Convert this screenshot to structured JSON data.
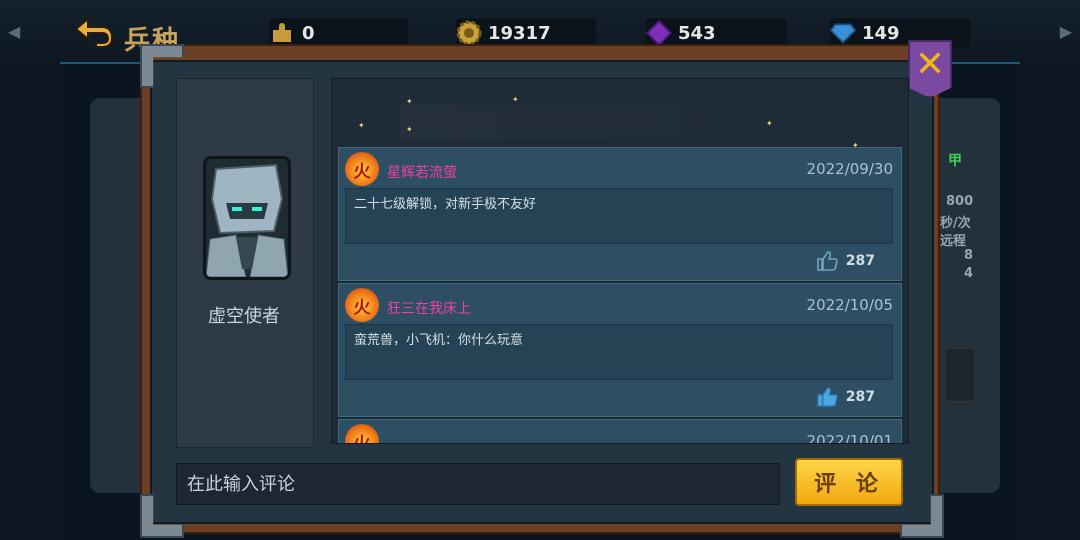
{
  "header": {
    "title": "兵种",
    "resources": [
      {
        "icon": "puzzle-icon",
        "value": "0"
      },
      {
        "icon": "gear-coin-icon",
        "value": "19317"
      },
      {
        "icon": "purple-crystal-icon",
        "value": "543"
      },
      {
        "icon": "blue-diamond-icon",
        "value": "149"
      }
    ]
  },
  "background": {
    "right_values": [
      "800",
      "秒/次",
      "远程",
      "8",
      "4"
    ],
    "right_green": "甲"
  },
  "modal": {
    "unit_name": "虚空使者",
    "comments": [
      {
        "user": "星辉若流萤",
        "date": "2022/09/30",
        "text": "二十七级解锁，对新手极不友好",
        "likes": "287",
        "liked": false
      },
      {
        "user": "狂三在我床上",
        "date": "2022/10/05",
        "text": "蛮荒兽，小飞机：你什么玩意",
        "likes": "287",
        "liked": true
      },
      {
        "user": "",
        "date": "2022/10/01",
        "text": "",
        "likes": "",
        "liked": false
      }
    ],
    "input_placeholder": "在此输入评论",
    "submit_label": "评 论"
  },
  "colors": {
    "frame_wood": "#6b3f24",
    "username": "#f03ea8",
    "submit_gold": "#f2a90f",
    "close_purple": "#7a4aa3"
  }
}
